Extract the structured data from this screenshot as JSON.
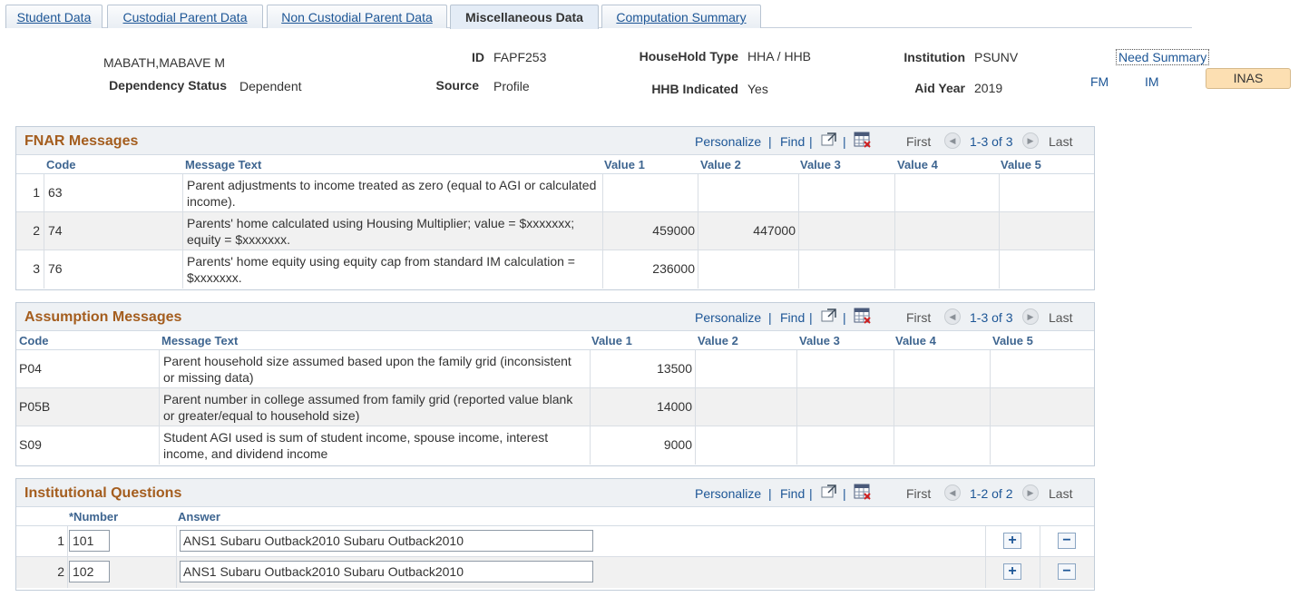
{
  "tabs": [
    {
      "label": "Student Data",
      "active": false
    },
    {
      "label": "Custodial Parent Data",
      "active": false
    },
    {
      "label": "Non Custodial Parent Data",
      "active": false
    },
    {
      "label": "Miscellaneous Data",
      "active": true
    },
    {
      "label": "Computation Summary",
      "active": false
    }
  ],
  "header": {
    "name": "MABATH,MABAVE M",
    "dependency_label": "Dependency Status",
    "dependency_value": "Dependent",
    "id_label": "ID",
    "id_value": "FAPF253",
    "source_label": "Source",
    "source_value": "Profile",
    "household_label": "HouseHold Type",
    "household_value": "HHA / HHB",
    "hhb_label": "HHB Indicated",
    "hhb_value": "Yes",
    "institution_label": "Institution",
    "institution_value": "PSUNV",
    "aidyear_label": "Aid Year",
    "aidyear_value": "2019",
    "need_summary_link": "Need Summary",
    "fm_link": "FM",
    "im_link": "IM",
    "inas_button": "INAS"
  },
  "grid_toolbar": {
    "personalize": "Personalize",
    "find": "Find",
    "first": "First",
    "last": "Last"
  },
  "fnar": {
    "title": "FNAR Messages",
    "range": "1-3 of 3",
    "columns": [
      "Code",
      "Message Text",
      "Value 1",
      "Value 2",
      "Value 3",
      "Value 4",
      "Value 5"
    ],
    "rows": [
      {
        "no": "1",
        "code": "63",
        "text": "Parent adjustments to income treated as zero (equal to AGI or calculated income).",
        "v1": "",
        "v2": "",
        "v3": "",
        "v4": "",
        "v5": ""
      },
      {
        "no": "2",
        "code": "74",
        "text": "Parents' home calculated using Housing Multiplier; value = $xxxxxxx; equity = $xxxxxxx.",
        "v1": "459000",
        "v2": "447000",
        "v3": "",
        "v4": "",
        "v5": ""
      },
      {
        "no": "3",
        "code": "76",
        "text": "Parents' home equity using equity cap from standard IM calculation  = $xxxxxxx.",
        "v1": "236000",
        "v2": "",
        "v3": "",
        "v4": "",
        "v5": ""
      }
    ]
  },
  "assumption": {
    "title": "Assumption Messages",
    "range": "1-3 of 3",
    "columns": [
      "Code",
      "Message Text",
      "Value 1",
      "Value 2",
      "Value 3",
      "Value 4",
      "Value 5"
    ],
    "rows": [
      {
        "code": "P04",
        "text": "Parent household size assumed based upon the family grid (inconsistent or missing data)",
        "v1": "13500"
      },
      {
        "code": "P05B",
        "text": "Parent number in college assumed from family grid (reported value blank or greater/equal to household size)",
        "v1": "14000"
      },
      {
        "code": "S09",
        "text": "Student AGI used is sum of student income, spouse income, interest income, and dividend income",
        "v1": "9000"
      }
    ]
  },
  "institutional": {
    "title": "Institutional Questions",
    "range": "1-2 of 2",
    "columns": [
      "*Number",
      "Answer"
    ],
    "rows": [
      {
        "no": "1",
        "number": "101",
        "answer": "ANS1 Subaru Outback2010 Subaru Outback2010"
      },
      {
        "no": "2",
        "number": "102",
        "answer": "ANS1 Subaru Outback2010 Subaru Outback2010"
      }
    ],
    "add_symbol": "+",
    "remove_symbol": "−"
  }
}
